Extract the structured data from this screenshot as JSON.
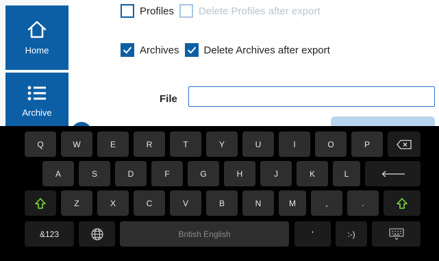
{
  "sidebar": {
    "items": [
      {
        "label": "Home",
        "icon": "home-icon"
      },
      {
        "label": "Archive",
        "icon": "list-icon"
      }
    ]
  },
  "options": {
    "profiles_label": "Profiles",
    "profiles_checked": false,
    "delete_profiles_label": "Delete Profiles after export",
    "delete_profiles_checked": false,
    "archives_label": "Archives",
    "archives_checked": true,
    "delete_archives_label": "Delete Archives after export",
    "delete_archives_checked": true
  },
  "file": {
    "label": "File",
    "value": ""
  },
  "keyboard": {
    "row1": [
      "Q",
      "W",
      "E",
      "R",
      "T",
      "Y",
      "U",
      "I",
      "O",
      "P"
    ],
    "row2": [
      "A",
      "S",
      "D",
      "F",
      "G",
      "H",
      "J",
      "K",
      "L"
    ],
    "row3": [
      "Z",
      "X",
      "C",
      "V",
      "B",
      "N",
      "M",
      ",",
      "."
    ],
    "symbols_label": "&123",
    "space_label": "British English",
    "apostrophe_label": "'",
    "smiley_label": ":-)",
    "icons": {
      "backspace": "backspace-icon",
      "enter": "enter-icon",
      "shift": "shift-icon",
      "globe": "globe-icon",
      "hide": "keyboard-hide-icon"
    },
    "accent_color": "#7ddc3a"
  },
  "colors": {
    "primary": "#0d5fa5",
    "keyboard_bg": "#000000",
    "key_bg": "#2e2e2e"
  }
}
